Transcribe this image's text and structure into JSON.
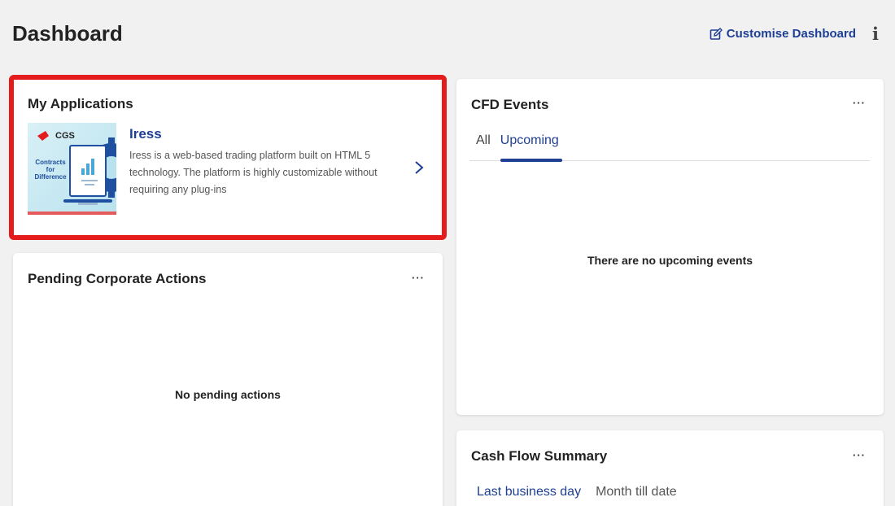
{
  "header": {
    "title": "Dashboard",
    "customise_label": "Customise Dashboard",
    "info_glyph": "i"
  },
  "my_applications": {
    "title": "My Applications",
    "app": {
      "name": "Iress",
      "description": "Iress is a web-based trading platform built on HTML 5 technology. The platform is highly customizable without requiring any plug-ins",
      "thumbnail_logo": "CGS",
      "thumbnail_caption": "Contracts for Difference"
    },
    "highlight_color": "#e41c1c"
  },
  "pending_actions": {
    "title": "Pending Corporate Actions",
    "more_label": "···",
    "empty_message": "No pending actions"
  },
  "cfd_events": {
    "title": "CFD Events",
    "more_label": "···",
    "tabs": [
      {
        "label": "All",
        "active": false
      },
      {
        "label": "Upcoming",
        "active": true
      }
    ],
    "empty_message": "There are no upcoming events"
  },
  "cash_flow": {
    "title": "Cash Flow Summary",
    "more_label": "···",
    "tabs": [
      {
        "label": "Last business day",
        "active": true
      },
      {
        "label": "Month till date",
        "active": false
      }
    ]
  },
  "colors": {
    "accent": "#1f3f95",
    "background": "#f1f1f1",
    "card": "#ffffff"
  },
  "icons": {
    "customise": "edit-icon",
    "info": "info-icon",
    "chevron": "chevron-right-icon",
    "more": "more-horizontal-icon"
  }
}
